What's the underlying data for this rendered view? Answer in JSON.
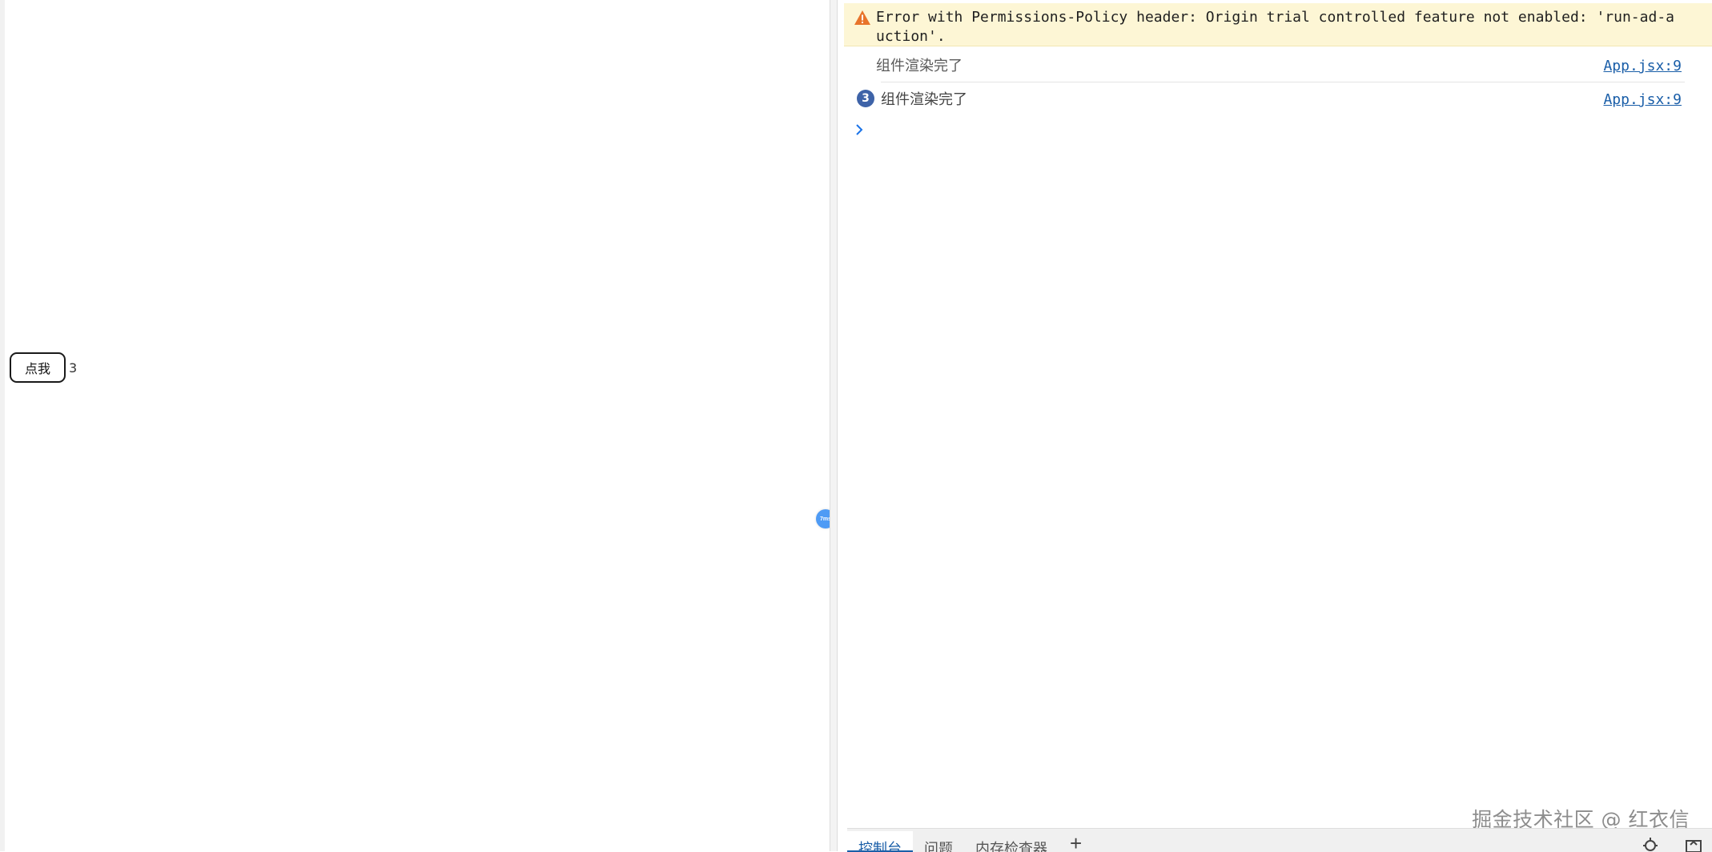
{
  "page": {
    "button_label": "点我",
    "count": "3",
    "floating_badge_text": "7ms"
  },
  "console": {
    "warning": {
      "text": "Error with Permissions-Policy header: Origin trial controlled feature not enabled: 'run-ad-auction'."
    },
    "messages": [
      {
        "text": "组件渲染完了",
        "source": "App.jsx:9"
      },
      {
        "text": "组件渲染完了",
        "source": "App.jsx:9",
        "repeat_count": "3"
      }
    ]
  },
  "drawer": {
    "tabs": [
      "控制台",
      "问题",
      "内存检查器"
    ],
    "add_tab": "+"
  },
  "watermark": "掘金技术社区 @ 红衣信",
  "colors": {
    "warning_bg": "#fdf6d5",
    "warning_icon": "#e8742b",
    "link": "#1a5ea8",
    "repeat_badge": "#3e63a8",
    "floating_badge": "#4e9bf5"
  }
}
